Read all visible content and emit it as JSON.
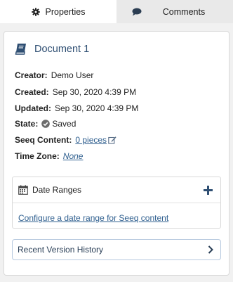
{
  "tabs": [
    {
      "label": "Properties",
      "icon": "gear-icon"
    },
    {
      "label": "Comments",
      "icon": "comment-icon"
    }
  ],
  "document": {
    "icon": "book-icon",
    "title": "Document 1"
  },
  "fields": {
    "creator": {
      "label": "Creator:",
      "value": "Demo User"
    },
    "created": {
      "label": "Created:",
      "value": "Sep 30, 2020 4:39 PM"
    },
    "updated": {
      "label": "Updated:",
      "value": "Sep 30, 2020 4:39 PM"
    },
    "state": {
      "label": "State:",
      "value": "Saved",
      "icon": "check-circle-icon"
    },
    "seeq_content": {
      "label": "Seeq Content:",
      "value": "0 pieces",
      "icon": "edit-icon"
    },
    "time_zone": {
      "label": "Time Zone:",
      "value": "None"
    }
  },
  "date_ranges": {
    "title": "Date Ranges",
    "icon": "calendar-icon",
    "add_icon": "plus-icon",
    "configure_link": "Configure a date range for Seeq content"
  },
  "version_history": {
    "label": "Recent Version History",
    "icon": "chevron-right-icon"
  },
  "colors": {
    "link": "#2f5f8f",
    "title": "#2f4f73",
    "inactive_tab": "#e9e9e9",
    "background": "#f1f1f1"
  }
}
